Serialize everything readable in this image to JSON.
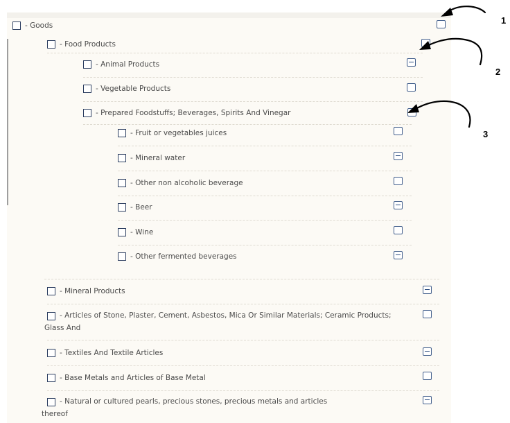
{
  "tree": {
    "root": {
      "label": "- Goods"
    },
    "food": {
      "label": "- Food Products"
    },
    "animal": {
      "label": "- Animal Products"
    },
    "vegetable": {
      "label": "- Vegetable Products"
    },
    "prepared": {
      "label": "- Prepared Foodstuffs; Beverages, Spirits And Vinegar"
    },
    "juices": {
      "label": "- Fruit or vegetables juices"
    },
    "mineral_water": {
      "label": "- Mineral water"
    },
    "non_alcoholic": {
      "label": "- Other non alcoholic beverage"
    },
    "beer": {
      "label": "- Beer"
    },
    "wine": {
      "label": "- Wine"
    },
    "fermented": {
      "label": "- Other fermented beverages"
    },
    "mineral_products": {
      "label": "- Mineral Products"
    },
    "stone": {
      "label": "- Articles of Stone, Plaster, Cement, Asbestos, Mica Or Similar Materials; Ceramic Products; Glass And"
    },
    "textiles": {
      "label": "- Textiles And Textile Articles"
    },
    "base_metals": {
      "label": "- Base Metals and Articles of Base Metal"
    },
    "pearls": {
      "label": "- Natural or cultured pearls, precious stones, precious metals and articles thereof"
    }
  },
  "callouts": {
    "one": "1",
    "two": "2",
    "three": "3"
  },
  "colors": {
    "panel_bg": "#fcfaf5",
    "checkbox_border": "#2c3e60",
    "toggle_border": "#3f5c8a",
    "separator": "#dedad0"
  }
}
